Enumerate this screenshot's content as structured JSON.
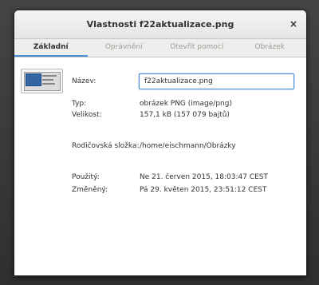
{
  "window": {
    "title": "Vlastnosti f22aktualizace.png",
    "close_glyph": "×"
  },
  "tabs": [
    {
      "label": "Základní",
      "active": true
    },
    {
      "label": "Oprávnění",
      "active": false
    },
    {
      "label": "Otevřít pomocí",
      "active": false
    },
    {
      "label": "Obrázek",
      "active": false
    }
  ],
  "properties": {
    "name_label": "Název:",
    "name_value": "f22aktualizace.png",
    "type_label": "Typ:",
    "type_value": "obrázek PNG (image/png)",
    "size_label": "Velikost:",
    "size_value": "157,1 kB (157 079 bajtů)",
    "parent_label": "Rodičovská složka:",
    "parent_value": "/home/eischmann/Obrázky",
    "accessed_label": "Použitý:",
    "accessed_value": "Ne 21. červen 2015, 18:03:47 CEST",
    "modified_label": "Změněný:",
    "modified_value": "Pá 29. květen 2015, 23:51:12 CEST"
  },
  "colors": {
    "accent": "#4a90d9",
    "text": "#2e3436",
    "inactive_tab_text": "#9a9c97"
  },
  "icons": {
    "close": "close-icon",
    "thumbnail": "file-thumbnail-icon"
  }
}
